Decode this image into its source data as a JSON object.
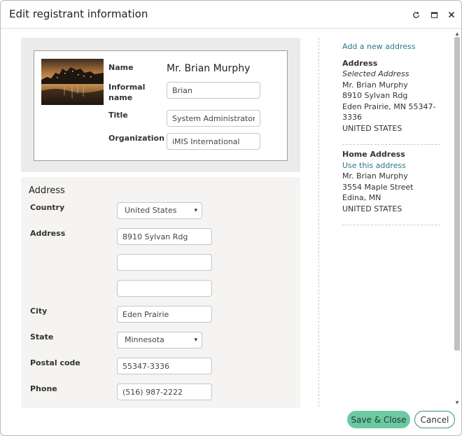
{
  "window": {
    "title": "Edit registrant information"
  },
  "titlebar_icons": [
    "refresh-icon",
    "maximize-icon",
    "close-icon"
  ],
  "profile": {
    "name_label": "Name",
    "name_value": "Mr. Brian Murphy",
    "informal_label": "Informal name",
    "informal_value": "Brian",
    "title_label": "Title",
    "title_value": "System Administrator",
    "organization_label": "Organization",
    "organization_value": "iMIS International"
  },
  "address_form": {
    "heading": "Address",
    "country_label": "Country",
    "country_value": "United States",
    "address_label": "Address",
    "address_line1": "8910 Sylvan Rdg",
    "address_line2": "",
    "address_line3": "",
    "city_label": "City",
    "city_value": "Eden Prairie",
    "state_label": "State",
    "state_value": "Minnesota",
    "postal_label": "Postal code",
    "postal_value": "55347-3336",
    "phone_label": "Phone",
    "phone_value": "(516) 987-2222"
  },
  "address_panel": {
    "add_link": "Add a new address",
    "selected": {
      "heading": "Address",
      "subheading": "Selected Address",
      "line1": "Mr. Brian Murphy",
      "line2": "8910 Sylvan Rdg",
      "line3": "Eden Prairie, MN 55347-",
      "line4": "3336",
      "line5": "UNITED STATES"
    },
    "home": {
      "heading": "Home Address",
      "use_link": "Use this address",
      "line1": "Mr. Brian Murphy",
      "line2": "3554 Maple Street",
      "line3": "Edina, MN",
      "line4": "UNITED STATES"
    }
  },
  "footer": {
    "save_label": "Save & Close",
    "cancel_label": "Cancel"
  },
  "colors": {
    "accent_link": "#2a7a8a",
    "save_button": "#6cc9a2",
    "cancel_border": "#2f8f8a"
  }
}
